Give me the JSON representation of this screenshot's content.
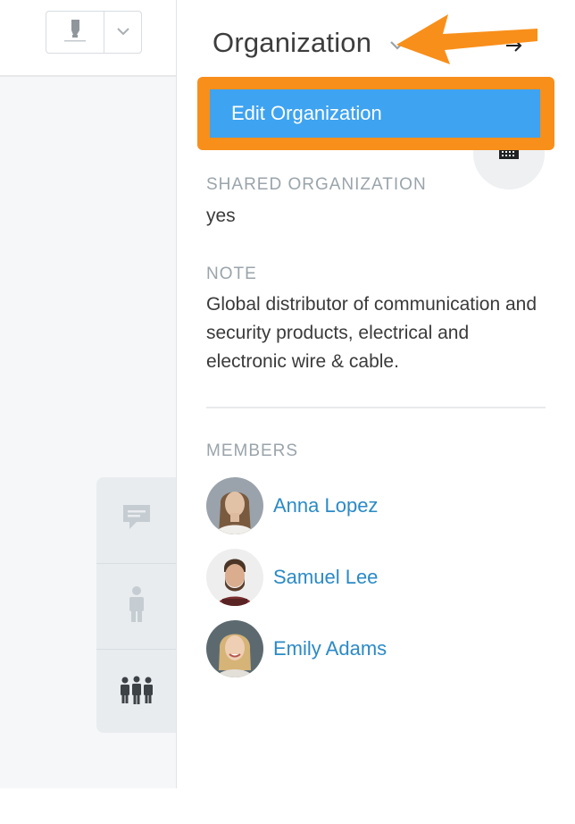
{
  "toolbar": {
    "edit_icon": "highlighter-icon",
    "dropdown_icon": "chevron-down-icon"
  },
  "rail": {
    "items": [
      {
        "icon": "chat-bubble-icon",
        "active": false
      },
      {
        "icon": "person-icon",
        "active": false
      },
      {
        "icon": "group-icon",
        "active": true
      }
    ]
  },
  "sidebar": {
    "title": "Organization",
    "title_icon": "chevron-down-icon",
    "close_icon": "arrow-right-icon",
    "avatar_icon": "building-icon",
    "menu": {
      "edit_label": "Edit Organization"
    },
    "shared": {
      "label": "SHARED ORGANIZATION",
      "value": "yes"
    },
    "note": {
      "label": "NOTE",
      "value": "Global distributor of communication and security products, electrical and electronic wire & cable."
    },
    "members": {
      "label": "MEMBERS",
      "items": [
        {
          "name": "Anna Lopez"
        },
        {
          "name": "Samuel Lee"
        },
        {
          "name": "Emily Adams"
        }
      ]
    }
  },
  "colors": {
    "accent": "#3ea3f0",
    "annotation": "#f88f1a",
    "link": "#2b8ac6",
    "label": "#9aa4ab"
  }
}
